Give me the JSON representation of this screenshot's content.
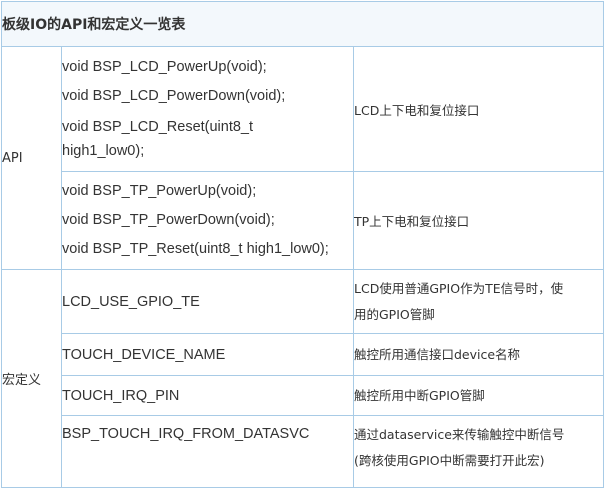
{
  "table": {
    "title": "板级IO的API和宏定义一览表",
    "api_group": {
      "label": "API",
      "rows": [
        {
          "functions": [
            "void  BSP_LCD_PowerUp(void);",
            "void  BSP_LCD_PowerDown(void);",
            "void  BSP_LCD_Reset(uint8_t",
            "high1_low0);"
          ],
          "description": "LCD上下电和复位接口"
        },
        {
          "functions": [
            "void  BSP_TP_PowerUp(void);",
            "void  BSP_TP_PowerDown(void);",
            "void  BSP_TP_Reset(uint8_t  high1_low0);"
          ],
          "description": "TP上下电和复位接口"
        }
      ]
    },
    "macro_group": {
      "label": "宏定义",
      "rows": [
        {
          "name": "LCD_USE_GPIO_TE",
          "description_lines": [
            "LCD使用普通GPIO作为TE信号时，使",
            "用的GPIO管脚"
          ]
        },
        {
          "name": "TOUCH_DEVICE_NAME",
          "description_lines": [
            "触控所用通信接口device名称"
          ]
        },
        {
          "name": "TOUCH_IRQ_PIN",
          "description_lines": [
            "触控所用中断GPIO管脚"
          ]
        },
        {
          "name": "BSP_TOUCH_IRQ_FROM_DATASVC",
          "description_lines": [
            "通过dataservice来传输触控中断信号",
            "(跨核使用GPIO中断需要打开此宏)"
          ]
        }
      ]
    }
  },
  "colors": {
    "border": "#a8cbe6",
    "header_bg": "#f3f8fc",
    "text": "#333333"
  }
}
